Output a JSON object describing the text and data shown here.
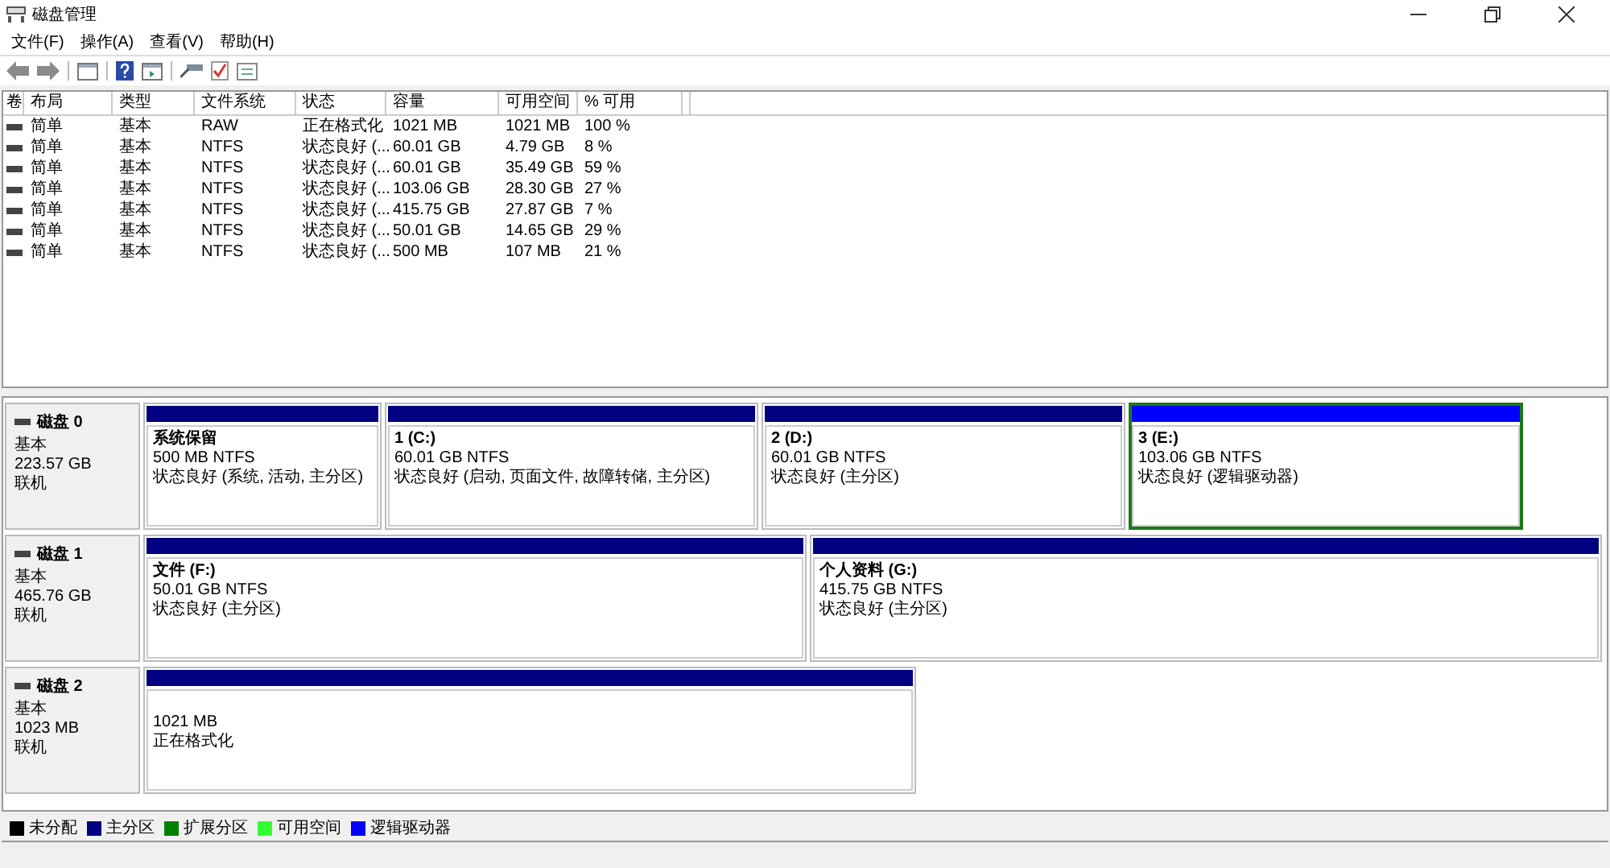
{
  "window": {
    "title": "磁盘管理"
  },
  "menu": [
    "文件(F)",
    "操作(A)",
    "查看(V)",
    "帮助(H)"
  ],
  "table": {
    "columns": [
      "卷",
      "布局",
      "类型",
      "文件系统",
      "状态",
      "容量",
      "可用空间",
      "% 可用"
    ],
    "rows": [
      {
        "cells": [
          "",
          "简单",
          "基本",
          "RAW",
          "正在格式化",
          "1021 MB",
          "1021 MB",
          "100 %"
        ]
      },
      {
        "cells": [
          "",
          "简单",
          "基本",
          "NTFS",
          "状态良好 (...",
          "60.01 GB",
          "4.79 GB",
          "8 %"
        ]
      },
      {
        "cells": [
          "",
          "简单",
          "基本",
          "NTFS",
          "状态良好 (...",
          "60.01 GB",
          "35.49 GB",
          "59 %"
        ]
      },
      {
        "cells": [
          "",
          "简单",
          "基本",
          "NTFS",
          "状态良好 (...",
          "103.06 GB",
          "28.30 GB",
          "27 %"
        ]
      },
      {
        "cells": [
          "",
          "简单",
          "基本",
          "NTFS",
          "状态良好 (...",
          "415.75 GB",
          "27.87 GB",
          "7 %"
        ]
      },
      {
        "cells": [
          "",
          "简单",
          "基本",
          "NTFS",
          "状态良好 (...",
          "50.01 GB",
          "14.65 GB",
          "29 %"
        ]
      },
      {
        "cells": [
          "",
          "简单",
          "基本",
          "NTFS",
          "状态良好 (...",
          "500 MB",
          "107 MB",
          "21 %"
        ]
      }
    ]
  },
  "disks": [
    {
      "name": "磁盘 0",
      "type": "基本",
      "size": "223.57 GB",
      "status": "联机",
      "partitions": [
        {
          "kind": "primary",
          "selected": false,
          "title": "系统保留",
          "size": "500 MB NTFS",
          "status": "状态良好 (系统, 活动, 主分区)"
        },
        {
          "kind": "primary",
          "selected": false,
          "title": "1  (C:)",
          "size": "60.01 GB NTFS",
          "status": "状态良好 (启动, 页面文件, 故障转储, 主分区)"
        },
        {
          "kind": "primary",
          "selected": false,
          "title": "2  (D:)",
          "size": "60.01 GB NTFS",
          "status": "状态良好 (主分区)"
        },
        {
          "kind": "logical",
          "selected": true,
          "title": "3  (E:)",
          "size": "103.06 GB NTFS",
          "status": "状态良好 (逻辑驱动器)"
        }
      ]
    },
    {
      "name": "磁盘 1",
      "type": "基本",
      "size": "465.76 GB",
      "status": "联机",
      "partitions": [
        {
          "kind": "primary",
          "selected": false,
          "title": "文件  (F:)",
          "size": "50.01 GB NTFS",
          "status": "状态良好 (主分区)"
        },
        {
          "kind": "primary",
          "selected": false,
          "title": "个人资料  (G:)",
          "size": "415.75 GB NTFS",
          "status": "状态良好 (主分区)"
        }
      ]
    },
    {
      "name": "磁盘 2",
      "type": "基本",
      "size": "1023 MB",
      "status": "联机",
      "partitions": [
        {
          "kind": "primary",
          "selected": false,
          "size": "1021 MB",
          "status": "正在格式化"
        }
      ]
    }
  ],
  "legend": [
    {
      "label": "未分配",
      "color": "#000000"
    },
    {
      "label": "主分区",
      "color": "#000080"
    },
    {
      "label": "扩展分区",
      "color": "#008000"
    },
    {
      "label": "可用空间",
      "color": "#33ff33"
    },
    {
      "label": "逻辑驱动器",
      "color": "#0000ff"
    }
  ]
}
